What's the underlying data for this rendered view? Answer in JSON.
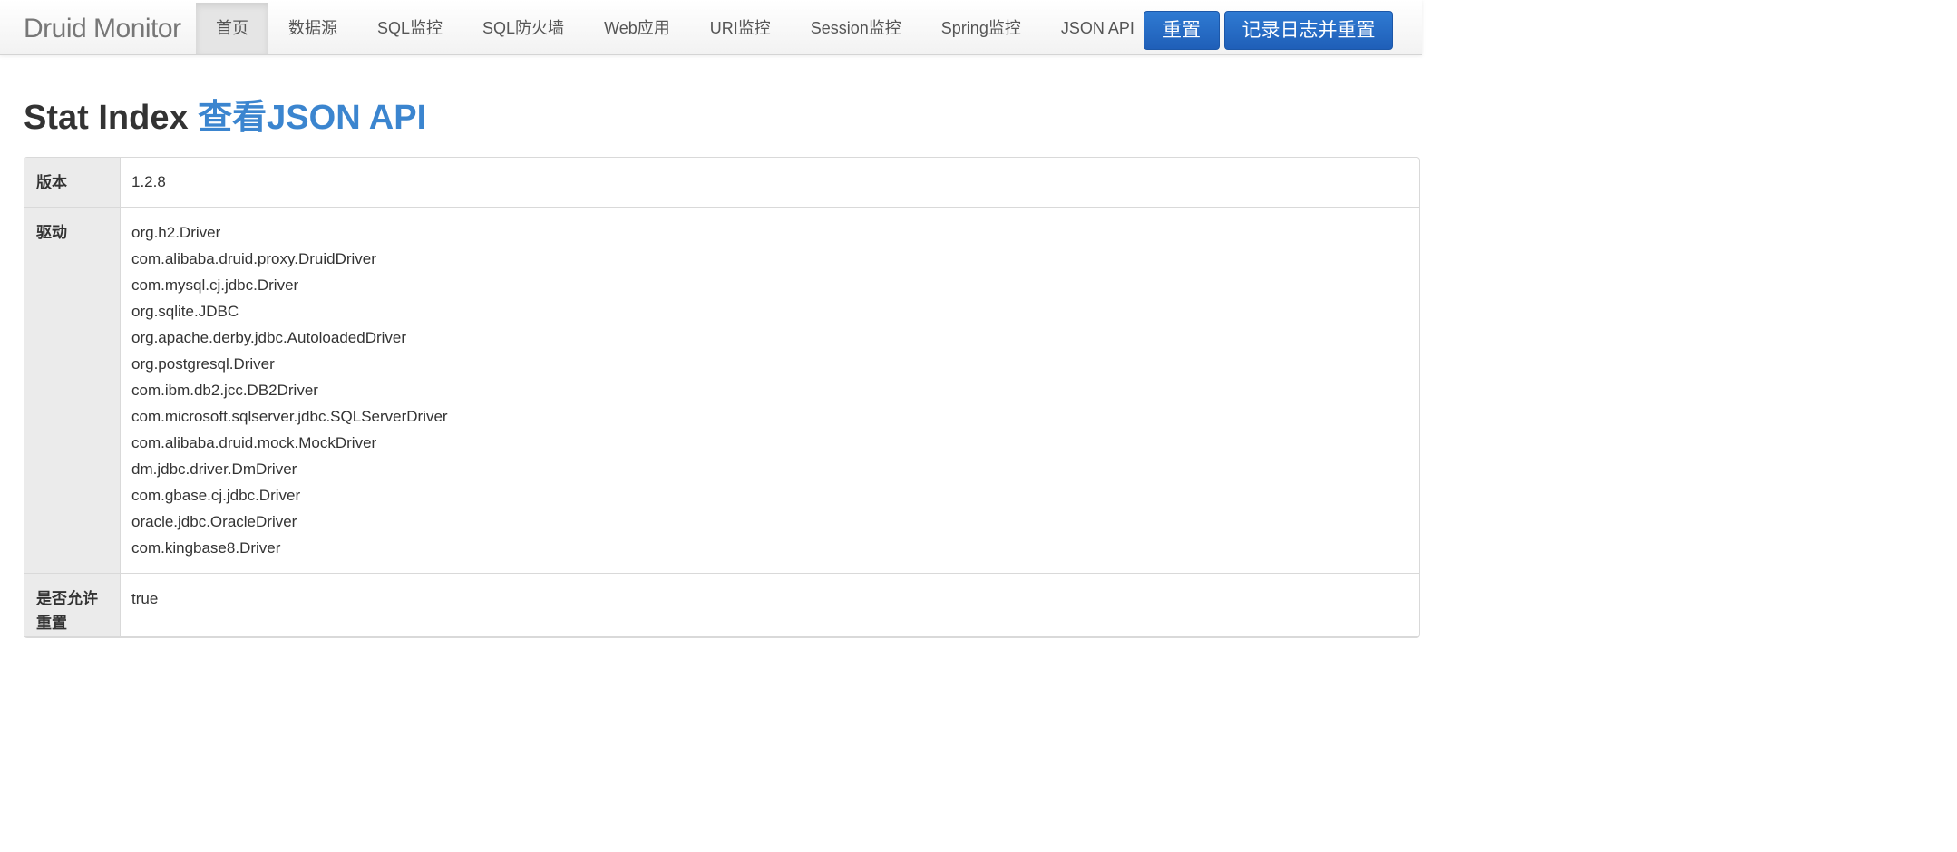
{
  "navbar": {
    "brand": "Druid Monitor",
    "items": [
      {
        "label": "首页",
        "active": true
      },
      {
        "label": "数据源",
        "active": false
      },
      {
        "label": "SQL监控",
        "active": false
      },
      {
        "label": "SQL防火墙",
        "active": false
      },
      {
        "label": "Web应用",
        "active": false
      },
      {
        "label": "URI监控",
        "active": false
      },
      {
        "label": "Session监控",
        "active": false
      },
      {
        "label": "Spring监控",
        "active": false
      },
      {
        "label": "JSON API",
        "active": false
      }
    ],
    "reset_label": "重置",
    "log_reset_label": "记录日志并重置"
  },
  "page": {
    "title": "Stat Index",
    "json_link": "查看JSON API"
  },
  "stats": {
    "version": {
      "key": "版本",
      "value": "1.2.8"
    },
    "drivers": {
      "key": "驱动",
      "values": [
        "org.h2.Driver",
        "com.alibaba.druid.proxy.DruidDriver",
        "com.mysql.cj.jdbc.Driver",
        "org.sqlite.JDBC",
        "org.apache.derby.jdbc.AutoloadedDriver",
        "org.postgresql.Driver",
        "com.ibm.db2.jcc.DB2Driver",
        "com.microsoft.sqlserver.jdbc.SQLServerDriver",
        "com.alibaba.druid.mock.MockDriver",
        "dm.jdbc.driver.DmDriver",
        "com.gbase.cj.jdbc.Driver",
        "oracle.jdbc.OracleDriver",
        "com.kingbase8.Driver"
      ]
    },
    "allow_reset": {
      "key": "是否允许重置",
      "value": "true"
    }
  },
  "colors": {
    "primary_button": "#2a6fc9",
    "link": "#3b85cf",
    "key_cell_bg": "#ebebeb"
  }
}
